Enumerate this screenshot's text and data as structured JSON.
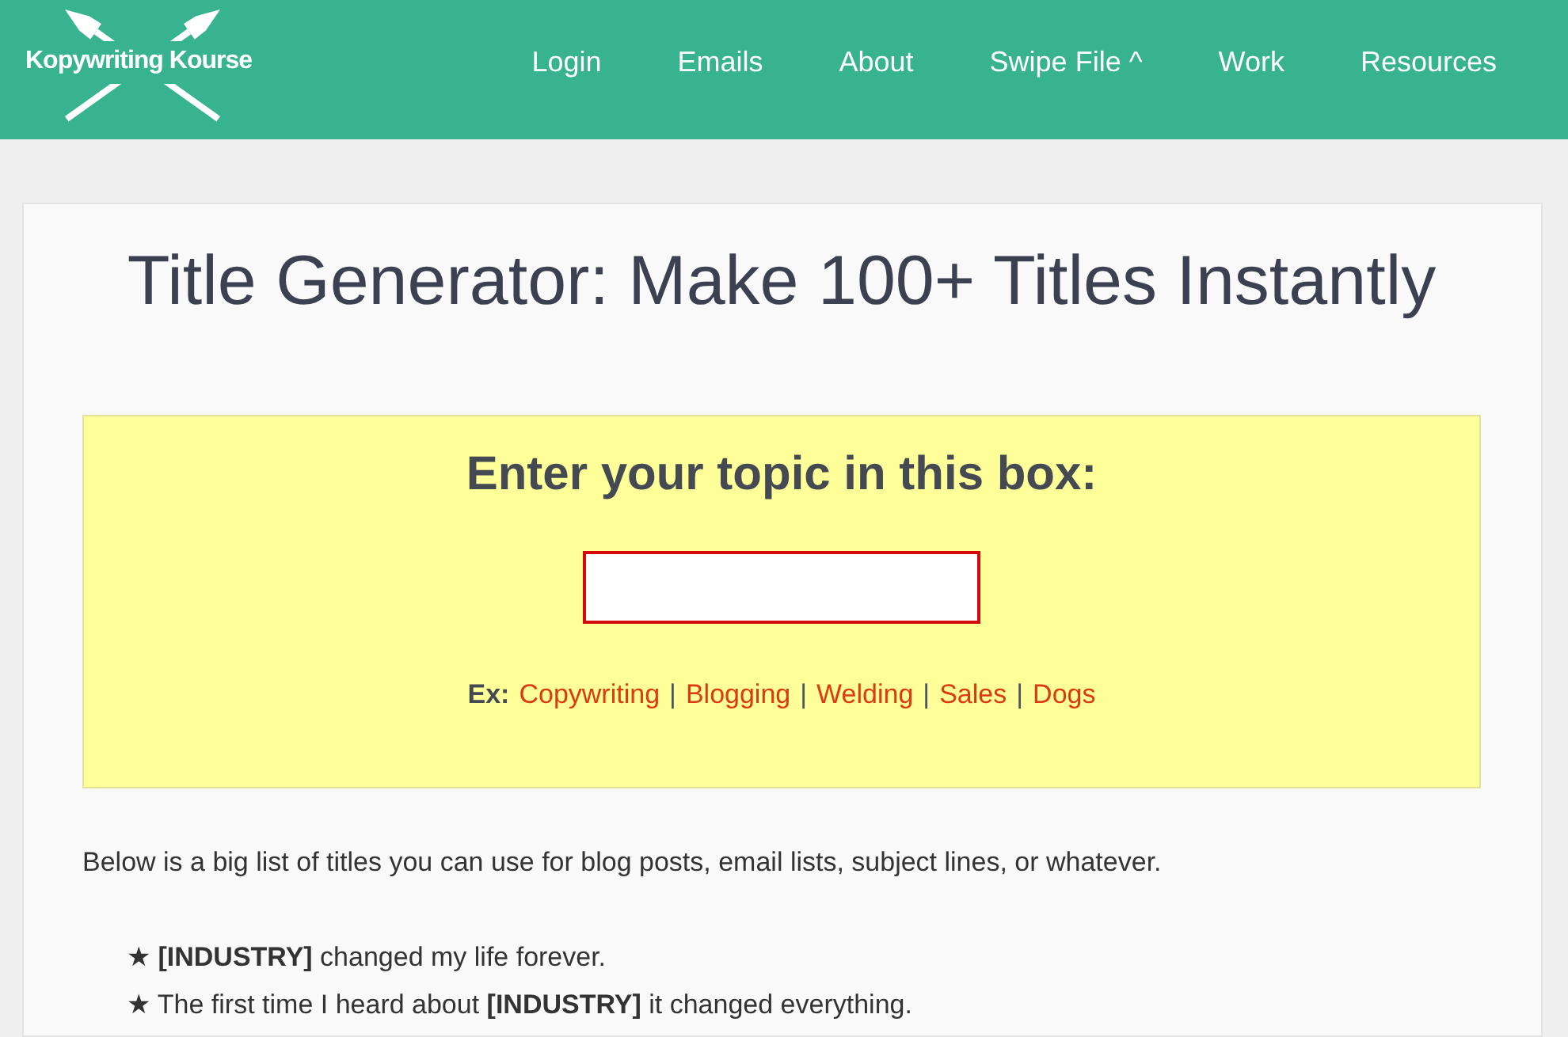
{
  "header": {
    "logo": {
      "text": "Kopywriting Kourse"
    },
    "nav": [
      "Login",
      "Emails",
      "About",
      "Swipe File ^",
      "Work",
      "Resources"
    ]
  },
  "card": {
    "title": "Title Generator: Make 100+ Titles Instantly",
    "topic_box": {
      "heading": "Enter your topic in this box:",
      "examples": {
        "label": "Ex:",
        "items": [
          {
            "kind": "link",
            "text": "Copywriting"
          },
          {
            "kind": "separator",
            "text": "|"
          },
          {
            "kind": "link",
            "text": "Blogging"
          },
          {
            "kind": "separator",
            "text": "|"
          },
          {
            "kind": "link",
            "text": "Welding"
          },
          {
            "kind": "separator",
            "text": "|"
          },
          {
            "kind": "link",
            "text": "Sales"
          },
          {
            "kind": "separator",
            "text": "|"
          },
          {
            "kind": "link",
            "text": "Dogs"
          }
        ]
      }
    },
    "intro": "Below is a big list of titles you can use for blog posts, email lists, subject lines, or whatever.",
    "titles": [
      "★ **[INDUSTRY]** changed my life forever.",
      "★ The first time I heard about **[INDUSTRY]** it changed everything."
    ]
  }
}
